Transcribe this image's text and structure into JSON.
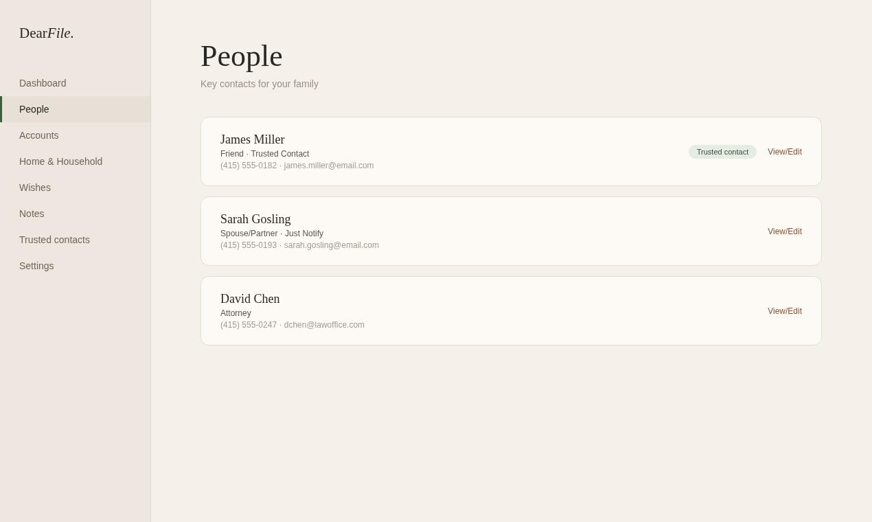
{
  "sidebar": {
    "logo": {
      "text": "Dear",
      "emphasis": "File."
    },
    "items": [
      {
        "label": "Dashboard",
        "selected": false
      },
      {
        "label": "People",
        "selected": true
      },
      {
        "label": "Accounts",
        "selected": false
      },
      {
        "label": "Home & Household",
        "selected": false
      },
      {
        "label": "Wishes",
        "selected": false
      },
      {
        "label": "Notes",
        "selected": false
      },
      {
        "label": "Trusted contacts",
        "selected": false
      },
      {
        "label": "Settings",
        "selected": false
      }
    ]
  },
  "page": {
    "title": "People",
    "subtitle": "Key contacts for your family"
  },
  "people": [
    {
      "name": "James Miller",
      "roles": "Friend · Trusted Contact",
      "contact": "(415) 555-0182 · james.miller@email.com",
      "badge": "Trusted contact",
      "action": "View/Edit"
    },
    {
      "name": "Sarah Gosling",
      "roles": "Spouse/Partner · Just Notify",
      "contact": "(415) 555-0193 · sarah.gosling@email.com",
      "action": "View/Edit"
    },
    {
      "name": "David Chen",
      "roles": "Attorney",
      "contact": "(415) 555-0247 · dchen@lawoffice.com",
      "action": "View/Edit"
    }
  ]
}
